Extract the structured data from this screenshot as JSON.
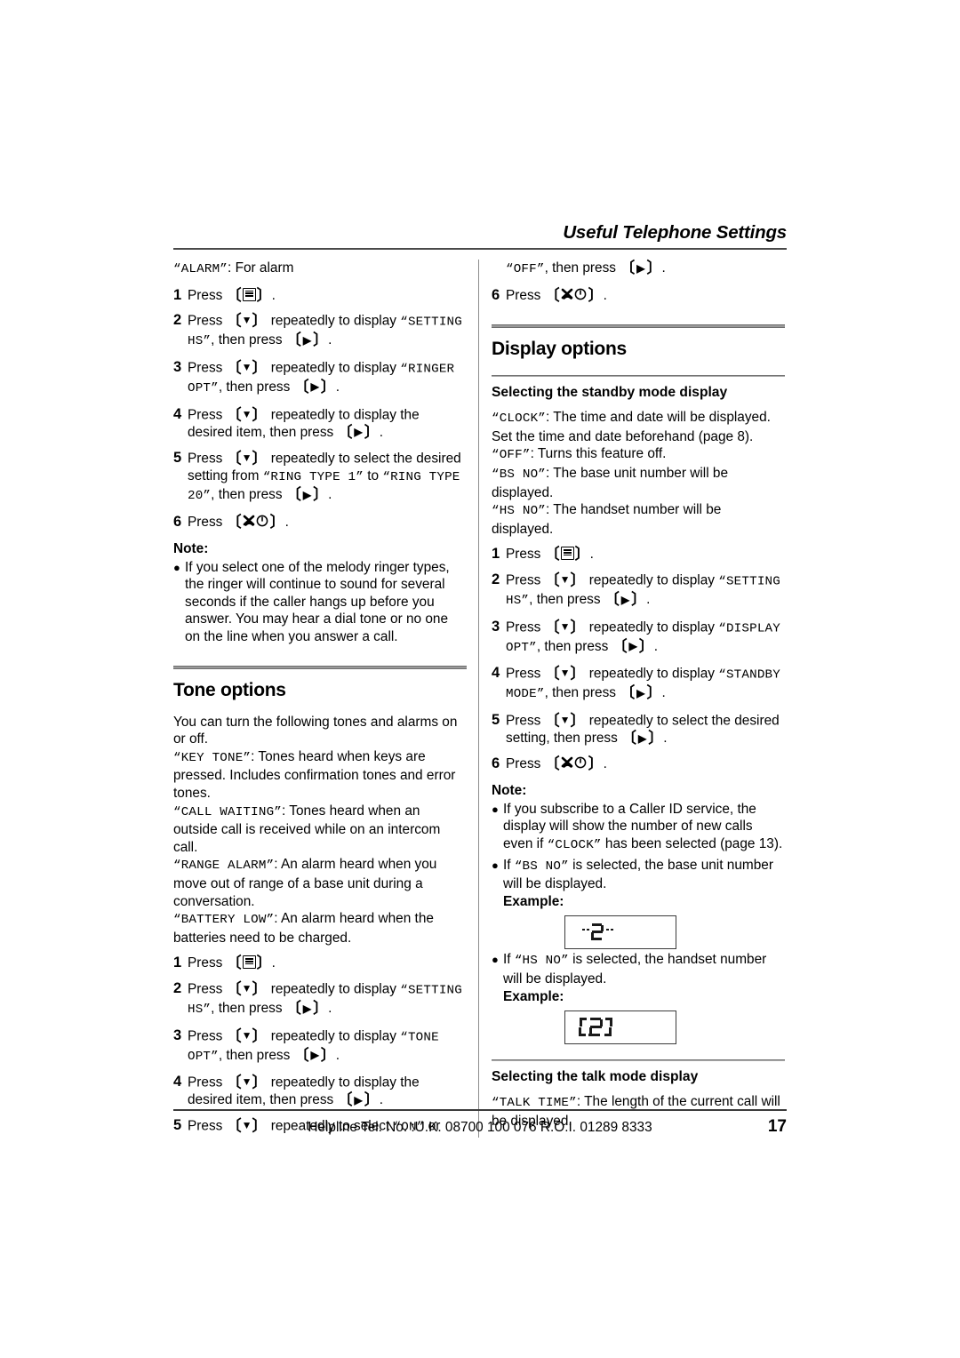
{
  "header": {
    "running_head": "Useful Telephone Settings"
  },
  "left_column": {
    "alarm_line": {
      "term": "ALARM",
      "desc": ": For alarm"
    },
    "ringer_steps": [
      {
        "num": "1",
        "parts": [
          {
            "t": "text",
            "v": "Press "
          },
          {
            "t": "key",
            "v": "menu"
          },
          {
            "t": "text",
            "v": "."
          }
        ]
      },
      {
        "num": "2",
        "parts": [
          {
            "t": "text",
            "v": "Press "
          },
          {
            "t": "key",
            "v": "down"
          },
          {
            "t": "text",
            "v": " repeatedly to display "
          },
          {
            "t": "lcdq",
            "v": "SETTING HS"
          },
          {
            "t": "text",
            "v": ", then press "
          },
          {
            "t": "key",
            "v": "right"
          },
          {
            "t": "text",
            "v": "."
          }
        ]
      },
      {
        "num": "3",
        "parts": [
          {
            "t": "text",
            "v": "Press "
          },
          {
            "t": "key",
            "v": "down"
          },
          {
            "t": "text",
            "v": " repeatedly to display "
          },
          {
            "t": "lcdq",
            "v": "RINGER OPT"
          },
          {
            "t": "text",
            "v": ", then press "
          },
          {
            "t": "key",
            "v": "right"
          },
          {
            "t": "text",
            "v": "."
          }
        ]
      },
      {
        "num": "4",
        "parts": [
          {
            "t": "text",
            "v": "Press "
          },
          {
            "t": "key",
            "v": "down"
          },
          {
            "t": "text",
            "v": " repeatedly to display the desired item, then press "
          },
          {
            "t": "key",
            "v": "right"
          },
          {
            "t": "text",
            "v": "."
          }
        ]
      },
      {
        "num": "5",
        "parts": [
          {
            "t": "text",
            "v": "Press "
          },
          {
            "t": "key",
            "v": "down"
          },
          {
            "t": "text",
            "v": " repeatedly to select the desired setting from "
          },
          {
            "t": "lcdq",
            "v": "RING TYPE 1"
          },
          {
            "t": "text",
            "v": " to "
          },
          {
            "t": "lcdq",
            "v": "RING TYPE 20"
          },
          {
            "t": "text",
            "v": ", then press "
          },
          {
            "t": "key",
            "v": "right"
          },
          {
            "t": "text",
            "v": "."
          }
        ]
      },
      {
        "num": "6",
        "parts": [
          {
            "t": "text",
            "v": "Press "
          },
          {
            "t": "key",
            "v": "off"
          },
          {
            "t": "text",
            "v": "."
          }
        ]
      }
    ],
    "note_title": "Note:",
    "note_bullets": [
      "If you select one of the melody ringer types, the ringer will continue to sound for several seconds if the caller hangs up before you answer. You may hear a dial tone or no one on the line when you answer a call."
    ],
    "tone_heading": "Tone options",
    "tone_intro": "You can turn the following tones and alarms on or off.",
    "tone_defs": [
      {
        "term": "KEY TONE",
        "desc": ": Tones heard when keys are pressed. Includes confirmation tones and error tones."
      },
      {
        "term": "CALL WAITING",
        "desc": ": Tones heard when an outside call is received while on an intercom call."
      },
      {
        "term": "RANGE ALARM",
        "desc": ": An alarm heard when you move out of range of a base unit during a conversation."
      },
      {
        "term": "BATTERY LOW",
        "desc": ": An alarm heard when the batteries need to be charged."
      }
    ],
    "tone_steps": [
      {
        "num": "1",
        "parts": [
          {
            "t": "text",
            "v": "Press "
          },
          {
            "t": "key",
            "v": "menu"
          },
          {
            "t": "text",
            "v": "."
          }
        ]
      },
      {
        "num": "2",
        "parts": [
          {
            "t": "text",
            "v": "Press "
          },
          {
            "t": "key",
            "v": "down"
          },
          {
            "t": "text",
            "v": " repeatedly to display "
          },
          {
            "t": "lcdq",
            "v": "SETTING HS"
          },
          {
            "t": "text",
            "v": ", then press "
          },
          {
            "t": "key",
            "v": "right"
          },
          {
            "t": "text",
            "v": "."
          }
        ]
      },
      {
        "num": "3",
        "parts": [
          {
            "t": "text",
            "v": "Press "
          },
          {
            "t": "key",
            "v": "down"
          },
          {
            "t": "text",
            "v": " repeatedly to display "
          },
          {
            "t": "lcdq",
            "v": "TONE OPT"
          },
          {
            "t": "text",
            "v": ", then press "
          },
          {
            "t": "key",
            "v": "right"
          },
          {
            "t": "text",
            "v": "."
          }
        ]
      },
      {
        "num": "4",
        "parts": [
          {
            "t": "text",
            "v": "Press "
          },
          {
            "t": "key",
            "v": "down"
          },
          {
            "t": "text",
            "v": " repeatedly to display the desired item, then press "
          },
          {
            "t": "key",
            "v": "right"
          },
          {
            "t": "text",
            "v": "."
          }
        ]
      },
      {
        "num": "5",
        "parts": [
          {
            "t": "text",
            "v": "Press "
          },
          {
            "t": "key",
            "v": "down"
          },
          {
            "t": "text",
            "v": " repeatedly to select "
          },
          {
            "t": "lcdq",
            "v": "ON"
          },
          {
            "t": "text",
            "v": " or"
          }
        ]
      }
    ]
  },
  "right_column": {
    "continued_step": {
      "parts": [
        {
          "t": "lcdq",
          "v": "OFF"
        },
        {
          "t": "text",
          "v": ", then press "
        },
        {
          "t": "key",
          "v": "right"
        },
        {
          "t": "text",
          "v": "."
        }
      ]
    },
    "step6": {
      "num": "6",
      "parts": [
        {
          "t": "text",
          "v": "Press "
        },
        {
          "t": "key",
          "v": "off"
        },
        {
          "t": "text",
          "v": "."
        }
      ]
    },
    "display_heading": "Display options",
    "standby_subheading": "Selecting the standby mode display",
    "standby_defs": [
      {
        "term": "CLOCK",
        "desc": ": The time and date will be displayed. Set the time and date beforehand (page 8)."
      },
      {
        "term": "OFF",
        "desc": ": Turns this feature off."
      },
      {
        "term": "BS NO",
        "desc": ": The base unit number will be displayed."
      },
      {
        "term": "HS NO",
        "desc": ": The handset number will be displayed."
      }
    ],
    "standby_steps": [
      {
        "num": "1",
        "parts": [
          {
            "t": "text",
            "v": "Press "
          },
          {
            "t": "key",
            "v": "menu"
          },
          {
            "t": "text",
            "v": "."
          }
        ]
      },
      {
        "num": "2",
        "parts": [
          {
            "t": "text",
            "v": "Press "
          },
          {
            "t": "key",
            "v": "down"
          },
          {
            "t": "text",
            "v": " repeatedly to display "
          },
          {
            "t": "lcdq",
            "v": "SETTING HS"
          },
          {
            "t": "text",
            "v": ", then press "
          },
          {
            "t": "key",
            "v": "right"
          },
          {
            "t": "text",
            "v": "."
          }
        ]
      },
      {
        "num": "3",
        "parts": [
          {
            "t": "text",
            "v": "Press "
          },
          {
            "t": "key",
            "v": "down"
          },
          {
            "t": "text",
            "v": " repeatedly to display "
          },
          {
            "t": "lcdq",
            "v": "DISPLAY OPT"
          },
          {
            "t": "text",
            "v": ", then press "
          },
          {
            "t": "key",
            "v": "right"
          },
          {
            "t": "text",
            "v": "."
          }
        ]
      },
      {
        "num": "4",
        "parts": [
          {
            "t": "text",
            "v": "Press "
          },
          {
            "t": "key",
            "v": "down"
          },
          {
            "t": "text",
            "v": " repeatedly to display "
          },
          {
            "t": "lcdq",
            "v": "STANDBY MODE"
          },
          {
            "t": "text",
            "v": ", then press "
          },
          {
            "t": "key",
            "v": "right"
          },
          {
            "t": "text",
            "v": "."
          }
        ]
      },
      {
        "num": "5",
        "parts": [
          {
            "t": "text",
            "v": "Press "
          },
          {
            "t": "key",
            "v": "down"
          },
          {
            "t": "text",
            "v": " repeatedly to select the desired setting, then press "
          },
          {
            "t": "key",
            "v": "right"
          },
          {
            "t": "text",
            "v": "."
          }
        ]
      },
      {
        "num": "6",
        "parts": [
          {
            "t": "text",
            "v": "Press "
          },
          {
            "t": "key",
            "v": "off"
          },
          {
            "t": "text",
            "v": "."
          }
        ]
      }
    ],
    "note_title": "Note:",
    "note_bullet_1": {
      "parts": [
        {
          "t": "text",
          "v": "If you subscribe to a Caller ID service, the display will show the number of new calls even if "
        },
        {
          "t": "lcdq",
          "v": "CLOCK"
        },
        {
          "t": "text",
          "v": " has been selected (page 13)."
        }
      ]
    },
    "note_bullet_2": {
      "parts": [
        {
          "t": "text",
          "v": "If "
        },
        {
          "t": "lcdq",
          "v": "BS NO"
        },
        {
          "t": "text",
          "v": " is selected, the base unit number will be displayed."
        }
      ]
    },
    "note_bullet_3": {
      "parts": [
        {
          "t": "text",
          "v": "If "
        },
        {
          "t": "lcdq",
          "v": "HS NO"
        },
        {
          "t": "text",
          "v": " is selected, the handset number will be displayed."
        }
      ]
    },
    "example_label_1": "Example:",
    "example_label_2": "Example:",
    "lcd_example_1": "2",
    "lcd_example_2": "[2]",
    "talk_subheading": "Selecting the talk mode display",
    "talk_def": {
      "term": "TALK TIME",
      "desc": ": The length of the current call will be displayed."
    }
  },
  "footer": {
    "helpline": "Helpline Tel. No. :U.K. 08700 100 076  R.O.I. 01289 8333",
    "page_number": "17"
  }
}
